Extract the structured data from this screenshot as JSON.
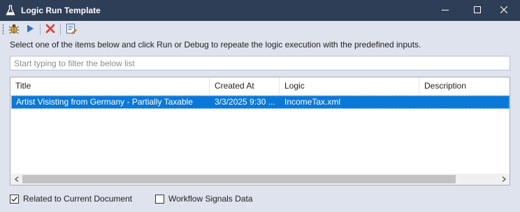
{
  "window": {
    "title": "Logic Run Template",
    "app_icon": "flask-icon",
    "controls": [
      "minimize-icon",
      "maximize-icon",
      "close-icon"
    ],
    "titlebar_color": "#2f3e57"
  },
  "toolbar": {
    "items": [
      "debug-bug-icon",
      "run-play-icon",
      "delete-x-icon",
      "edit-list-icon"
    ]
  },
  "instruction": "Select one of the items below and click Run or Debug to repeate the logic execution with the predefined inputs.",
  "filter": {
    "placeholder": "Start typing to filter the below list",
    "value": ""
  },
  "list": {
    "columns": [
      "Title",
      "Created At",
      "Logic",
      "Description"
    ],
    "rows": [
      {
        "title": "Artist Visisting from Germany - Partially Taxable",
        "created_at": "3/3/2025 9:30 ...",
        "logic": "IncomeTax.xml",
        "description": "",
        "selected": true
      }
    ],
    "selection_color": "#0a78d7"
  },
  "options": [
    {
      "label": "Related to Current Document",
      "checked": true
    },
    {
      "label": "Workflow Signals Data",
      "checked": false
    }
  ]
}
